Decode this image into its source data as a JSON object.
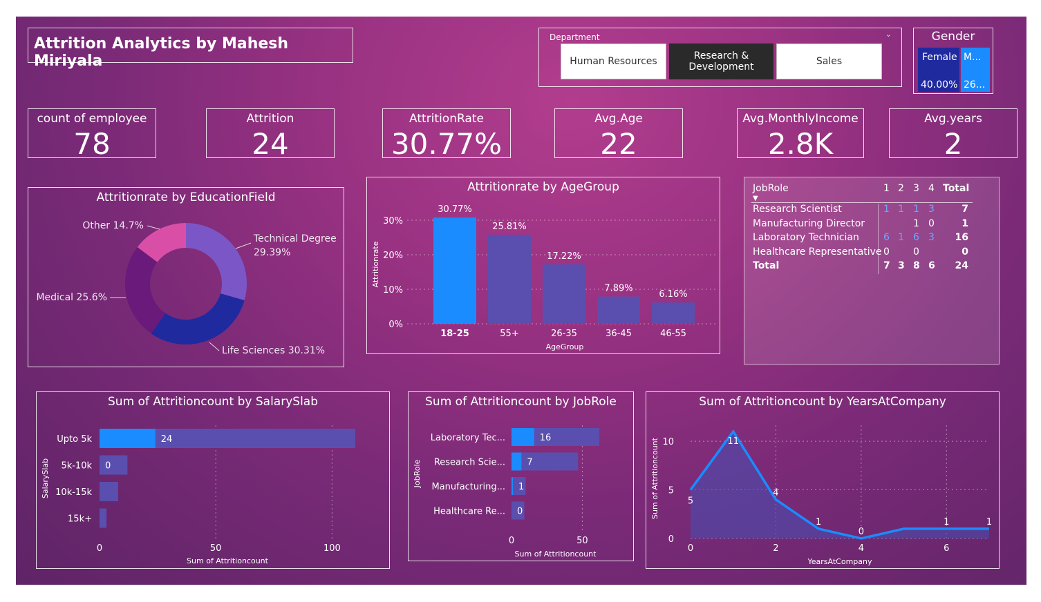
{
  "title": "Attrition Analytics by Mahesh Miriyala",
  "department_slicer": {
    "label": "Department",
    "options": [
      "Human Resources",
      "Research & Development",
      "Sales"
    ],
    "selected": "Research & Development"
  },
  "gender_slicer": {
    "label": "Gender",
    "female_label": "Female",
    "female_value": "40.00%",
    "male_label": "M...",
    "male_value": "26..."
  },
  "kpis": [
    {
      "label": "count of employee",
      "value": "78"
    },
    {
      "label": "Attrition",
      "value": "24"
    },
    {
      "label": "AttritionRate",
      "value": "30.77%"
    },
    {
      "label": "Avg.Age",
      "value": "22"
    },
    {
      "label": "Avg.MonthlyIncome",
      "value": "2.8K"
    },
    {
      "label": "Avg.years",
      "value": "2"
    }
  ],
  "colors": {
    "accent_blue": "#1a8cff",
    "bar_purple": "#5a4fae",
    "pie_technical": "#7b56c6",
    "pie_life": "#1f2a9f",
    "pie_medical": "#6a1a7a",
    "pie_other": "#d94fa8"
  },
  "matrix": {
    "header": [
      "JobRole",
      "1",
      "2",
      "3",
      "4",
      "Total"
    ],
    "rows": [
      {
        "role": "Research Scientist",
        "c1": "1",
        "c2": "1",
        "c3": "1",
        "c4": "3",
        "total": "7"
      },
      {
        "role": "Manufacturing Director",
        "c1": "",
        "c2": "",
        "c3": "1",
        "c4": "0",
        "total": "1"
      },
      {
        "role": "Laboratory Technician",
        "c1": "6",
        "c2": "1",
        "c3": "6",
        "c4": "3",
        "total": "16"
      },
      {
        "role": "Healthcare Representative",
        "c1": "0",
        "c2": "",
        "c3": "0",
        "c4": "",
        "total": "0"
      }
    ],
    "total_row": {
      "role": "Total",
      "c1": "7",
      "c2": "3",
      "c3": "8",
      "c4": "6",
      "total": "24"
    }
  },
  "chart_data": [
    {
      "type": "pie",
      "title": "Attritionrate by EducationField",
      "slices": [
        {
          "label": "Technical Degree",
          "value": 29.39,
          "display": "29.39%"
        },
        {
          "label": "Life Sciences",
          "value": 30.31,
          "display": "30.31%"
        },
        {
          "label": "Medical",
          "value": 25.6,
          "display": "25.6%"
        },
        {
          "label": "Other",
          "value": 14.7,
          "display": "14.7%"
        }
      ]
    },
    {
      "type": "bar",
      "title": "Attritionrate by AgeGroup",
      "xlabel": "AgeGroup",
      "ylabel": "Attritionrate",
      "categories": [
        "18-25",
        "55+",
        "26-35",
        "36-45",
        "46-55"
      ],
      "values": [
        30.77,
        25.81,
        17.22,
        7.89,
        6.16
      ],
      "labels": [
        "30.77%",
        "25.81%",
        "17.22%",
        "7.89%",
        "6.16%"
      ],
      "yticks": [
        "0%",
        "10%",
        "20%",
        "30%"
      ],
      "ylim": [
        0,
        30
      ]
    },
    {
      "type": "bar",
      "orientation": "horizontal",
      "title": "Sum of Attritioncount by SalarySlab",
      "xlabel": "Sum of Attritioncount",
      "ylabel": "SalarySlab",
      "categories": [
        "Upto 5k",
        "5k-10k",
        "10k-15k",
        "15k+"
      ],
      "values": [
        24,
        0,
        0,
        0
      ],
      "totals": [
        110,
        12,
        8,
        3
      ],
      "labels": [
        "24",
        "0",
        "",
        ""
      ],
      "xticks": [
        "0",
        "50",
        "100"
      ],
      "xlim": [
        0,
        110
      ]
    },
    {
      "type": "bar",
      "orientation": "horizontal",
      "title": "Sum of Attritioncount by JobRole",
      "xlabel": "Sum of Attritioncount",
      "ylabel": "JobRole",
      "categories": [
        "Laboratory Tec...",
        "Research Scie...",
        "Manufacturing...",
        "Healthcare Re..."
      ],
      "values": [
        16,
        7,
        1,
        0
      ],
      "totals": [
        62,
        47,
        10,
        9
      ],
      "labels": [
        "16",
        "7",
        "1",
        "0"
      ],
      "xticks": [
        "0",
        "50"
      ],
      "xlim": [
        0,
        62
      ]
    },
    {
      "type": "area",
      "title": "Sum of Attritioncount by YearsAtCompany",
      "xlabel": "YearsAtCompany",
      "ylabel": "Sum of Attritioncount",
      "x": [
        0,
        1,
        2,
        3,
        4,
        5,
        6,
        7
      ],
      "y": [
        5,
        11,
        4,
        1,
        0,
        1,
        1,
        1
      ],
      "point_labels": [
        "5",
        "11",
        "4",
        "1",
        "0",
        "",
        "1",
        "1"
      ],
      "xticks": [
        "0",
        "2",
        "4",
        "6"
      ],
      "yticks": [
        "0",
        "5",
        "10"
      ],
      "ylim": [
        0,
        11
      ]
    }
  ]
}
